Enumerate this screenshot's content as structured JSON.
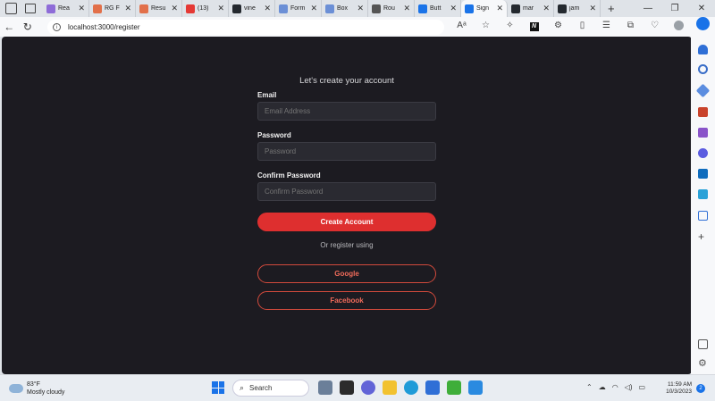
{
  "browser": {
    "tabs": [
      {
        "title": "Rea",
        "color": "#8e6cd8"
      },
      {
        "title": "RG F",
        "color": "#e2704a"
      },
      {
        "title": "Resu",
        "color": "#e2704a"
      },
      {
        "title": "(13)",
        "color": "#e53935"
      },
      {
        "title": "vine",
        "color": "#24292f"
      },
      {
        "title": "Form",
        "color": "#6b8fd6"
      },
      {
        "title": "Box",
        "color": "#6b8fd6"
      },
      {
        "title": "Rou",
        "color": "#555555"
      },
      {
        "title": "Butt",
        "color": "#1a73e8"
      },
      {
        "title": "Sign",
        "color": "#1a73e8",
        "active": true
      },
      {
        "title": "mar",
        "color": "#24292f"
      },
      {
        "title": "jam",
        "color": "#24292f"
      }
    ],
    "url": "localhost:3000/register"
  },
  "register": {
    "heading": "Let's create your account",
    "email_label": "Email",
    "email_placeholder": "Email Address",
    "password_label": "Password",
    "password_placeholder": "Password",
    "confirm_label": "Confirm Password",
    "confirm_placeholder": "Confirm Password",
    "create_button": "Create Account",
    "or_text": "Or register using",
    "google_button": "Google",
    "facebook_button": "Facebook"
  },
  "taskbar": {
    "temperature": "83°F",
    "weather": "Mostly cloudy",
    "search_label": "Search",
    "time": "11:59 AM",
    "date": "10/3/2023",
    "notification_count": "2"
  },
  "colors": {
    "page_bg": "#1c1b21",
    "accent_red": "#de2f2f",
    "outline_red": "#d24a3c"
  }
}
